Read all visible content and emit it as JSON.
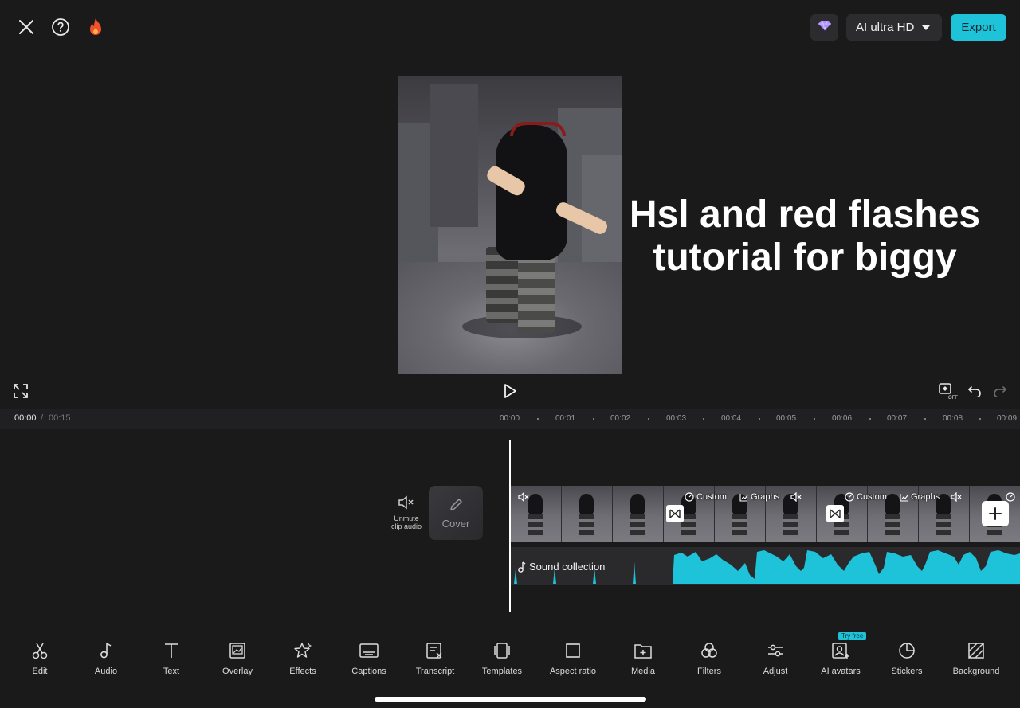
{
  "topbar": {
    "close_icon": "close-icon",
    "help_icon": "help-icon",
    "hot_icon": "flame-icon",
    "gem_icon": "gem-icon",
    "quality_label": "AI ultra HD",
    "export_label": "Export",
    "accent_color": "#1fc3d9"
  },
  "preview": {
    "overlay_title_line1": "Hsl and red flashes",
    "overlay_title_line2": "tutorial for biggy"
  },
  "controls": {
    "fullscreen_icon": "fullscreen-icon",
    "play_icon": "play-icon",
    "keyframe_icon": "keyframe-off-icon",
    "keyframe_badge": "OFF",
    "undo_icon": "undo-icon",
    "redo_icon": "redo-icon"
  },
  "timeline": {
    "current_time": "00:00",
    "separator": "/",
    "total_time": "00:15",
    "ruler_ticks": [
      "00:00",
      "00:01",
      "00:02",
      "00:03",
      "00:04",
      "00:05",
      "00:06",
      "00:07",
      "00:08",
      "00:09"
    ],
    "unmute_label_line1": "Unmute",
    "unmute_label_line2": "clip audio",
    "cover_label": "Cover",
    "clip_tags": [
      {
        "label": "Custom"
      },
      {
        "label": "Graphs"
      },
      {
        "label": "Custom"
      },
      {
        "label": "Graphs"
      }
    ],
    "audio_label": "Sound collection"
  },
  "toolbar": {
    "items": [
      {
        "label": "Edit",
        "icon": "scissors-icon"
      },
      {
        "label": "Audio",
        "icon": "music-note-icon"
      },
      {
        "label": "Text",
        "icon": "text-icon"
      },
      {
        "label": "Overlay",
        "icon": "overlay-icon"
      },
      {
        "label": "Effects",
        "icon": "effects-star-icon"
      },
      {
        "label": "Captions",
        "icon": "captions-icon"
      },
      {
        "label": "Transcript",
        "icon": "transcript-icon"
      },
      {
        "label": "Templates",
        "icon": "templates-icon"
      },
      {
        "label": "Aspect ratio",
        "icon": "aspect-ratio-icon"
      },
      {
        "label": "Media",
        "icon": "media-add-icon"
      },
      {
        "label": "Filters",
        "icon": "filters-icon"
      },
      {
        "label": "Adjust",
        "icon": "adjust-sliders-icon"
      },
      {
        "label": "AI avatars",
        "icon": "ai-avatar-icon"
      },
      {
        "label": "Stickers",
        "icon": "stickers-icon"
      },
      {
        "label": "Background",
        "icon": "background-icon"
      }
    ],
    "try_free_badge": "Try free"
  }
}
